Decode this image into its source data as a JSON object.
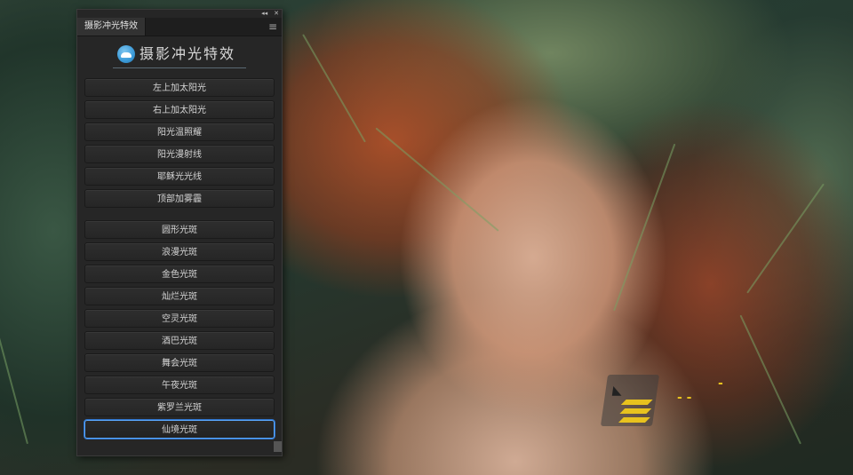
{
  "panel": {
    "tab_label": "摄影冲光特效",
    "title": "摄影冲光特效",
    "collapse_glyph": "◂◂",
    "close_glyph": "✕",
    "menu_glyph": "≡"
  },
  "buttons_group1": [
    {
      "label": "左上加太阳光"
    },
    {
      "label": "右上加太阳光"
    },
    {
      "label": "阳光温照耀"
    },
    {
      "label": "阳光漫射线"
    },
    {
      "label": "耶稣光光线"
    },
    {
      "label": "顶部加雾霾"
    }
  ],
  "buttons_group2": [
    {
      "label": "圆形光斑"
    },
    {
      "label": "浪漫光斑"
    },
    {
      "label": "金色光斑"
    },
    {
      "label": "灿烂光斑"
    },
    {
      "label": "空灵光斑"
    },
    {
      "label": "酒巴光斑"
    },
    {
      "label": "舞会光斑"
    },
    {
      "label": "午夜光斑"
    },
    {
      "label": "紫罗兰光斑"
    },
    {
      "label": "仙境光斑"
    }
  ],
  "selected_button": "仙境光斑",
  "colors": {
    "panel_bg": "#262626",
    "accent": "#5aa8ff",
    "logo_blue": "#3a9ad8",
    "watermark_yellow": "#e8c21e"
  }
}
